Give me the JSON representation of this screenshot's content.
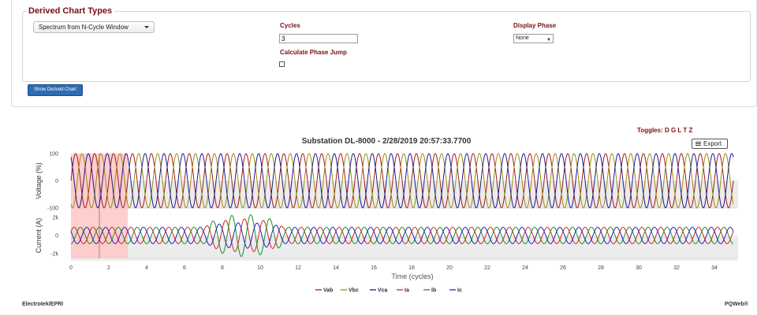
{
  "form": {
    "legend": "Derived Chart Types",
    "chart_type_selected": "Spectrum from N-Cycle Window",
    "cycles_label": "Cycles",
    "cycles_value": "3",
    "phase_jump_label": "Calculate Phase Jump",
    "phase_jump_checked": false,
    "display_phase_label": "Display Phase",
    "display_phase_selected": "None",
    "show_button": "Show Derived Chart"
  },
  "toolbar": {
    "toggles": "Toggles: D G L T Z",
    "export_label": "Export"
  },
  "colors": {
    "Vab": "#a31b1b",
    "Vbc": "#9a8c12",
    "Vca": "#1e1a8c",
    "Ia": "#d22424",
    "Ib": "#1f8f1f",
    "Ic": "#2222c0",
    "selection": "#ffc9c9",
    "title_red": "#7a1010",
    "button_blue": "#2d6cb3"
  },
  "chart_data": {
    "type": "line",
    "title": "Substation DL-8000 - 2/28/2019 20:57:33.7700",
    "xlabel": "Time (cycles)",
    "xlim": [
      0,
      35
    ],
    "x_ticks": [
      "0",
      "2",
      "4",
      "6",
      "8",
      "10",
      "12",
      "14",
      "16",
      "18",
      "20",
      "22",
      "24",
      "26",
      "28",
      "30",
      "32",
      "34"
    ],
    "selection_window": [
      0,
      3
    ],
    "cursor_x": 1.5,
    "panels": [
      {
        "ylabel": "Voltage (%)",
        "ylim": [
          -100,
          100
        ],
        "y_ticks": [
          "100",
          "0",
          "-100"
        ],
        "series": [
          {
            "name": "Vab",
            "amplitude": 100,
            "phase_deg": 0
          },
          {
            "name": "Vbc",
            "amplitude": 100,
            "phase_deg": -120
          },
          {
            "name": "Vca",
            "amplitude": 100,
            "phase_deg": 120
          }
        ]
      },
      {
        "ylabel": "Current (A)",
        "ylim": [
          -2500,
          2500
        ],
        "y_ticks": [
          "2k",
          "0",
          "-2k"
        ],
        "series": [
          {
            "name": "Ia",
            "amplitude": 900,
            "phase_deg": 30
          },
          {
            "name": "Ib",
            "amplitude": 900,
            "phase_deg": -90
          },
          {
            "name": "Ic",
            "amplitude": 900,
            "phase_deg": 150
          }
        ],
        "fault": {
          "start": 7.1,
          "end": 11.2,
          "peaks": {
            "Ia": 1800,
            "Ib": 2300,
            "Ic": 1400
          }
        }
      }
    ],
    "legend": [
      "Vab",
      "Vbc",
      "Vca",
      "Ia",
      "Ib",
      "Ic"
    ],
    "legend_position": "bottom-center"
  },
  "footer": {
    "left": "Electrotek/EPRI",
    "right": "PQWeb®"
  }
}
